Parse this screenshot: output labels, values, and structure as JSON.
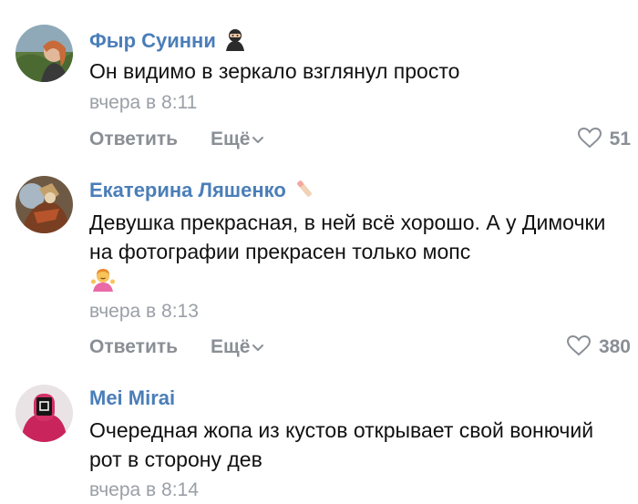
{
  "colors": {
    "author": "#4a7eb8",
    "text": "#111111",
    "muted": "#9a9fa6",
    "action": "#8a8f96",
    "background": "#ffffff"
  },
  "comments": [
    {
      "author": "Фыр Суинни",
      "author_badge_icon": "ninja-emoji-icon",
      "text": "Он видимо в зеркало взглянул просто",
      "date": "вчера в 8:11",
      "reply_label": "Ответить",
      "more_label": "Ещё",
      "likes": "51",
      "avatar_icon": "user-photo-avatar"
    },
    {
      "author": "Екатерина Ляшенко",
      "author_badge_icon": "nail-polish-emoji-icon",
      "text": "Девушка прекрасная, в ней всё хорошо. А у Димочки на фотографии прекрасен только мопс",
      "text_emoji_icon": "person-shrugging-emoji-icon",
      "date": "вчера в 8:13",
      "reply_label": "Ответить",
      "more_label": "Ещё",
      "likes": "380",
      "avatar_icon": "artwork-avatar"
    },
    {
      "author": "Mei Mirai",
      "text": "Очередная жопа из кустов открывает свой вонючий рот в сторону дев",
      "date": "вчера в 8:14",
      "avatar_icon": "masked-figure-avatar"
    }
  ]
}
